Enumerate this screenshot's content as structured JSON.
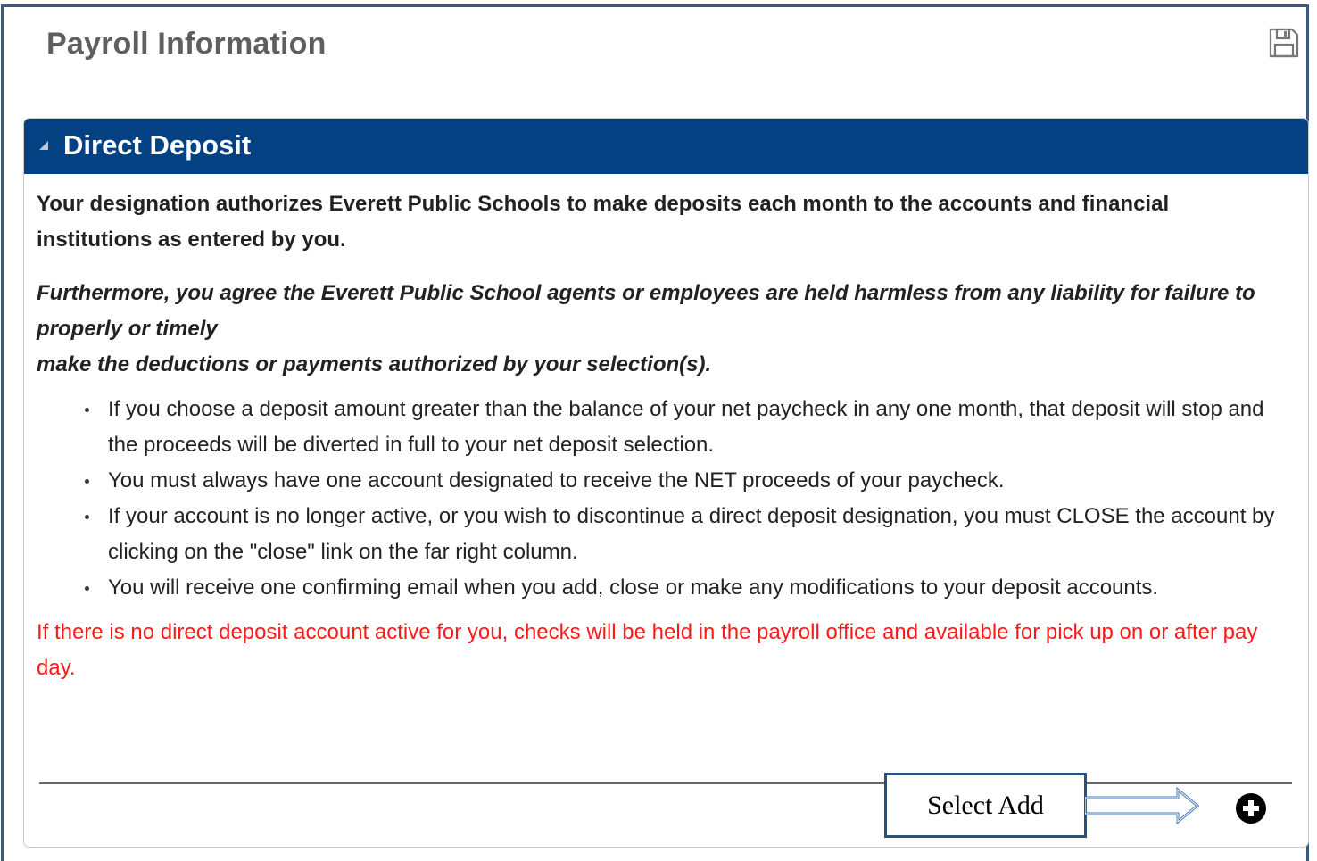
{
  "page": {
    "title": "Payroll Information",
    "save_icon": "save-icon"
  },
  "panel": {
    "title": "Direct Deposit",
    "collapse_icon": "triangle-collapse-icon",
    "header_color": "#034182",
    "paragraph1": "Your designation authorizes Everett Public Schools to make deposits each month to the accounts and financial institutions as entered by you.",
    "paragraph2_line1": "Furthermore, you agree the Everett Public School agents or employees are held harmless from any liability for failure to properly or timely",
    "paragraph2_line2": "make the deductions or payments authorized by your selection(s).",
    "bullets": [
      "If you choose a deposit amount greater than the balance of your net paycheck in any one month, that deposit will stop and the proceeds will be diverted in full to your net deposit selection.",
      "You must always have one account designated to receive the NET proceeds of your paycheck.",
      "If your account is no longer active, or you wish to discontinue a direct deposit designation, you must CLOSE the account by clicking on the \"close\" link on the far right column.",
      "You will receive one confirming email when you add, close or make any modifications to your deposit accounts."
    ],
    "warning": "If there is no direct deposit account active for you, checks will be held in the payroll office and available for pick up on or after pay day.",
    "warning_color": "#ff1a1a"
  },
  "callout": {
    "label": "Select Add",
    "arrow_icon": "right-arrow-icon"
  },
  "add_button": {
    "icon": "plus-circle-icon"
  }
}
